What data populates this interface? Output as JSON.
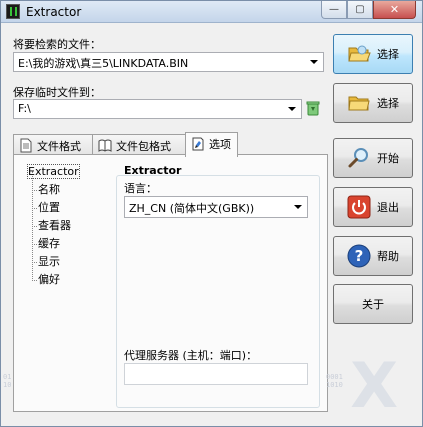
{
  "window": {
    "title": "Extractor"
  },
  "caption": {
    "minimize": "—",
    "maximize": "▢",
    "close": "✕"
  },
  "file_to_search": {
    "label": "将要检索的文件：",
    "value": "E:\\我的游戏\\真三5\\LINKDATA.BIN"
  },
  "temp_save": {
    "label": "保存临时文件到：",
    "value": "F:\\"
  },
  "tabs": [
    {
      "label": "文件格式",
      "icon": "document-icon"
    },
    {
      "label": "文件包格式",
      "icon": "book-icon"
    },
    {
      "label": "选项",
      "icon": "options-icon",
      "active": true
    }
  ],
  "tree": {
    "root": "Extractor",
    "items": [
      "名称",
      "位置",
      "查看器",
      "缓存",
      "显示",
      "偏好"
    ]
  },
  "options": {
    "group_title": "Extractor",
    "language_label": "语言：",
    "language_value": "ZH_CN (简体中文(GBK))",
    "proxy_label": "代理服务器 (主机：端口)：",
    "proxy_value": ""
  },
  "buttons": {
    "select1": "选择",
    "select2": "选择",
    "start": "开始",
    "exit": "退出",
    "help": "帮助",
    "about": "关于"
  },
  "colors": {
    "folder": "#f2c94c",
    "exit_red": "#d9442f",
    "help_blue": "#2e63b8"
  }
}
